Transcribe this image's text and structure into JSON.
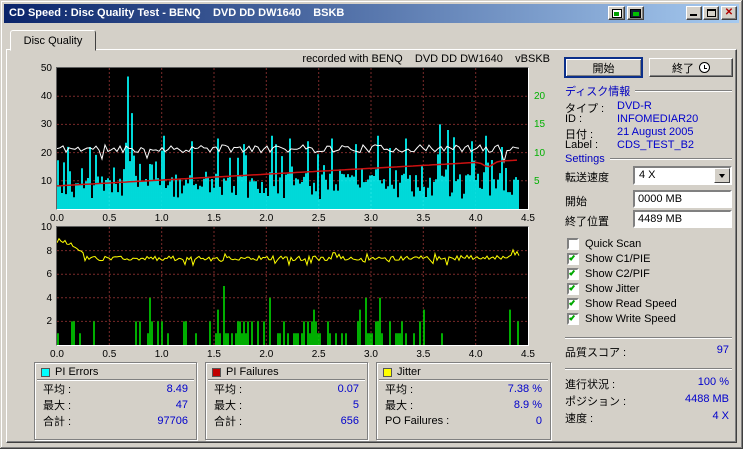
{
  "window": {
    "title": "CD Speed : Disc Quality Test - BENQ    DVD DD DW1640    BSKB",
    "buttons": {
      "close_glyph": "✕"
    }
  },
  "tab": {
    "label": "Disc Quality"
  },
  "chart_header": "recorded with BENQ    DVD DD DW1640    vBSKB",
  "buttons": {
    "start": "開始",
    "exit": "終了"
  },
  "disc_info": {
    "header": "ディスク情報",
    "rows": [
      {
        "key": "type",
        "label": "タイプ :",
        "value": "DVD-R"
      },
      {
        "key": "id",
        "label": "ID :",
        "value": "INFOMEDIAR20"
      },
      {
        "key": "date",
        "label": "日付 :",
        "value": "21 August 2005"
      },
      {
        "key": "label",
        "label": "Label :",
        "value": "CDS_TEST_B2"
      }
    ]
  },
  "settings": {
    "header": "Settings",
    "speed_label": "転送速度",
    "speed_value": "4 X",
    "start_label": "開始",
    "start_value": "0000 MB",
    "end_label": "終了位置",
    "end_value": "4489 MB",
    "checkboxes": [
      {
        "name": "quick-scan",
        "label": "Quick Scan",
        "checked": false
      },
      {
        "name": "show-c1-pie",
        "label": "Show C1/PIE",
        "checked": true
      },
      {
        "name": "show-c2-pif",
        "label": "Show C2/PIF",
        "checked": true
      },
      {
        "name": "show-jitter",
        "label": "Show Jitter",
        "checked": true
      },
      {
        "name": "show-read-speed",
        "label": "Show Read Speed",
        "checked": true
      },
      {
        "name": "show-write-speed",
        "label": "Show Write Speed",
        "checked": true
      }
    ]
  },
  "status": {
    "score_label": "品質スコア :",
    "score_value": "97",
    "progress_label": "進行状況 :",
    "progress_value": "100 %",
    "position_label": "ポジション :",
    "position_value": "4488 MB",
    "speed_label": "速度 :",
    "speed_value": "4 X"
  },
  "panels": [
    {
      "key": "pi-errors",
      "title": "PI Errors",
      "swatch": "#00ffff",
      "rows": [
        {
          "label": "平均 :",
          "value": "8.49"
        },
        {
          "label": "最大 :",
          "value": "47"
        },
        {
          "label": "合計 :",
          "value": "97706"
        }
      ]
    },
    {
      "key": "pi-failures",
      "title": "PI Failures",
      "swatch": "#c00000",
      "rows": [
        {
          "label": "平均 :",
          "value": "0.07"
        },
        {
          "label": "最大 :",
          "value": "5"
        },
        {
          "label": "合計 :",
          "value": "656"
        }
      ]
    },
    {
      "key": "jitter",
      "title": "Jitter",
      "swatch": "#ffff00",
      "rows": [
        {
          "label": "平均 :",
          "value": "7.38 %"
        },
        {
          "label": "最大 :",
          "value": "8.9 %"
        },
        {
          "label": "PO Failures :",
          "value": "0"
        }
      ]
    }
  ],
  "chart_data": [
    {
      "id": "pi-errors",
      "type": "mixed",
      "title": "PI Errors with read/write speed overlay",
      "x_unit": "GB",
      "x_range": [
        0,
        4.5
      ],
      "data_end": 4.43,
      "x_ticks": [
        "0.0",
        "0.5",
        "1.0",
        "1.5",
        "2.0",
        "2.5",
        "3.0",
        "3.5",
        "4.0",
        "4.5"
      ],
      "y_left": {
        "min": 0,
        "max": 50,
        "ticks": [
          50,
          40,
          30,
          20,
          10
        ]
      },
      "y_right": {
        "min": 0,
        "max": 25,
        "ticks": [
          20,
          15,
          10,
          5
        ],
        "color": "#00b000"
      },
      "grid": true,
      "series": [
        {
          "name": "PI Errors (C1/PIE)",
          "kind": "bars",
          "color": "#00ffff",
          "seed": 7,
          "base": 3.5,
          "spread": 9,
          "spike_prob": 0.3,
          "spike_amp": 14,
          "avg": 8.49,
          "max": 47,
          "spikes": [
            [
              0.67,
              47
            ],
            [
              0.7,
              34
            ],
            [
              0.3,
              22
            ],
            [
              1.02,
              26
            ],
            [
              1.28,
              24
            ],
            [
              1.52,
              25
            ],
            [
              1.78,
              23
            ],
            [
              2.05,
              26
            ],
            [
              2.22,
              25
            ],
            [
              2.38,
              24
            ],
            [
              2.62,
              25
            ],
            [
              2.85,
              23
            ],
            [
              3.05,
              26
            ],
            [
              3.32,
              25
            ],
            [
              3.65,
              30
            ],
            [
              3.72,
              28
            ],
            [
              3.95,
              24
            ],
            [
              4.08,
              26
            ],
            [
              4.25,
              22
            ]
          ]
        },
        {
          "name": "Read Speed",
          "kind": "noisy-line",
          "color": "#ffffff",
          "seed": 11,
          "base": 21.4,
          "noise": 1.4,
          "dip_prob": 0.06,
          "dip_amp": 4
        },
        {
          "name": "Write Speed",
          "kind": "trend-line",
          "color": "#cc1111",
          "start": 8.2,
          "end": 17.4,
          "dip_at": 4.12,
          "dip": 1.8
        }
      ]
    },
    {
      "id": "pif-jitter",
      "type": "mixed",
      "title": "PI Failures and Jitter",
      "x_unit": "GB",
      "x_range": [
        0,
        4.5
      ],
      "data_end": 4.43,
      "x_ticks": [
        "0.0",
        "0.5",
        "1.0",
        "1.5",
        "2.0",
        "2.5",
        "3.0",
        "3.5",
        "4.0",
        "4.5"
      ],
      "y_left": {
        "min": 0,
        "max": 10,
        "ticks": [
          10,
          8,
          6,
          4,
          2
        ]
      },
      "grid": true,
      "series": [
        {
          "name": "PI Failures (C2/PIF)",
          "kind": "sparse-bars",
          "color": "#00cc00",
          "seed": 23,
          "prob": 0.18,
          "dense_range": [
            1.25,
            3.35
          ],
          "dense_prob": 0.5,
          "avg": 0.07,
          "max": 5,
          "talls": [
            [
              0.88,
              4
            ],
            [
              1.58,
              5
            ],
            [
              2.02,
              4
            ],
            [
              2.45,
              3
            ],
            [
              2.95,
              4
            ],
            [
              3.08,
              4
            ],
            [
              3.5,
              3
            ]
          ]
        },
        {
          "name": "Jitter",
          "kind": "noisy-line",
          "color": "#ffff00",
          "seed": 31,
          "base": 7.35,
          "noise": 0.4,
          "start_spike": [
            0.05,
            8.9
          ],
          "avg": 7.38,
          "max": 8.9
        }
      ]
    }
  ]
}
